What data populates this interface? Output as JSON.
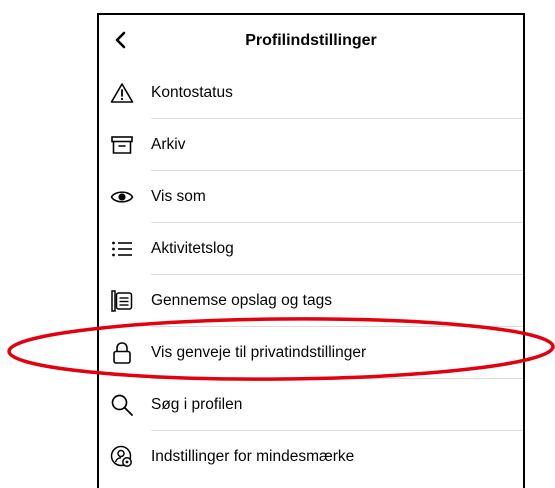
{
  "header": {
    "title": "Profilindstillinger",
    "back_icon": "chevron-left-icon"
  },
  "menu": {
    "items": [
      {
        "label": "Kontostatus",
        "icon": "warning-triangle-icon"
      },
      {
        "label": "Arkiv",
        "icon": "archive-box-icon"
      },
      {
        "label": "Vis som",
        "icon": "eye-icon"
      },
      {
        "label": "Aktivitetslog",
        "icon": "list-icon"
      },
      {
        "label": "Gennemse opslag og tags",
        "icon": "review-posts-icon"
      },
      {
        "label": "Vis genveje til privatindstillinger",
        "icon": "lock-icon"
      },
      {
        "label": "Søg i profilen",
        "icon": "search-icon"
      },
      {
        "label": "Indstillinger for mindesmærke",
        "icon": "memorial-settings-icon"
      }
    ]
  },
  "annotation": {
    "highlighted_item": "Vis genveje til privatindstillinger",
    "color": "#e3000f"
  }
}
